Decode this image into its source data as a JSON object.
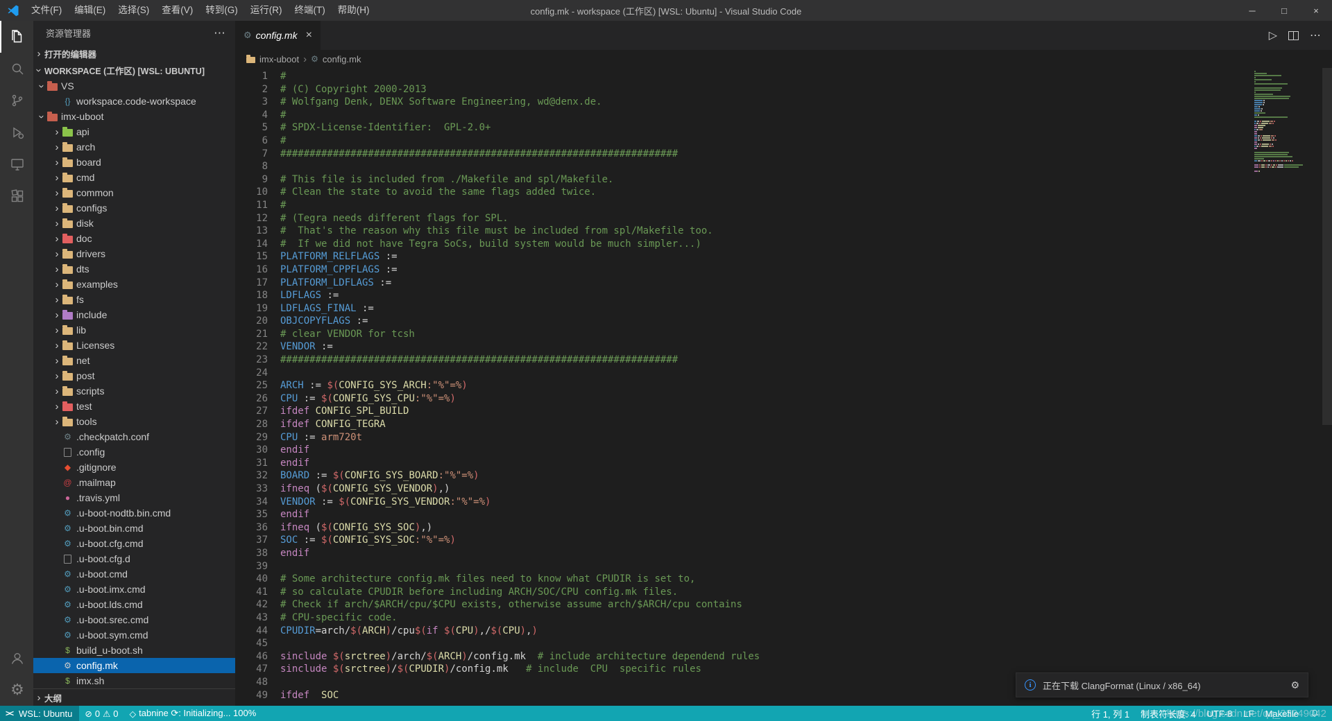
{
  "colors": {
    "titlebar": "#323233",
    "activitybar": "#333333",
    "sidebar": "#252526",
    "editor": "#1e1e1e",
    "statusbar": "#12a5b2",
    "statusbar_remote": "#0a7d8c",
    "selection": "#0a64ad",
    "vscode_blue": "#1f9cf0",
    "tok_c": "#6a9955",
    "tok_v": "#569cd6",
    "tok_k": "#c586c0",
    "tok_o": "#d4d4d4",
    "tok_d": "#d16969",
    "tok_n": "#dcdcaa",
    "tok_s": "#ce9178"
  },
  "title_bar": {
    "menus": [
      "文件(F)",
      "编辑(E)",
      "选择(S)",
      "查看(V)",
      "转到(G)",
      "运行(R)",
      "终端(T)",
      "帮助(H)"
    ],
    "title": "config.mk - workspace (工作区) [WSL: Ubuntu] - Visual Studio Code",
    "controls": {
      "minimize": "─",
      "maximize": "□",
      "close": "×"
    }
  },
  "activity_bar": {
    "icons": [
      "explorer-icon",
      "search-icon",
      "source-control-icon",
      "run-debug-icon",
      "remote-explorer-icon",
      "extensions-icon",
      "account-icon",
      "settings-gear-icon"
    ]
  },
  "sidebar": {
    "title": "资源管理器",
    "open_editors_label": "打开的编辑器",
    "workspace_label": "WORKSPACE (工作区) [WSL: UBUNTU]",
    "outline_label": "大纲",
    "tree": [
      {
        "label": "VS",
        "depth": 0,
        "icon": "folder",
        "icon_color": "#c65f4e",
        "chevron": true,
        "expanded": true
      },
      {
        "label": "workspace.code-workspace",
        "depth": 1,
        "icon": "braces",
        "icon_color": "#519aba"
      },
      {
        "label": "imx-uboot",
        "depth": 0,
        "icon": "folder",
        "icon_color": "#c65f4e",
        "chevron": true,
        "expanded": true
      },
      {
        "label": "api",
        "depth": 1,
        "icon": "folder",
        "icon_color": "#8bc34a",
        "chevron": true
      },
      {
        "label": "arch",
        "depth": 1,
        "icon": "folder",
        "icon_color": "#dcb67a",
        "chevron": true
      },
      {
        "label": "board",
        "depth": 1,
        "icon": "folder",
        "icon_color": "#dcb67a",
        "chevron": true
      },
      {
        "label": "cmd",
        "depth": 1,
        "icon": "folder",
        "icon_color": "#dcb67a",
        "chevron": true
      },
      {
        "label": "common",
        "depth": 1,
        "icon": "folder",
        "icon_color": "#dcb67a",
        "chevron": true
      },
      {
        "label": "configs",
        "depth": 1,
        "icon": "folder",
        "icon_color": "#dcb67a",
        "chevron": true
      },
      {
        "label": "disk",
        "depth": 1,
        "icon": "folder",
        "icon_color": "#dcb67a",
        "chevron": true
      },
      {
        "label": "doc",
        "depth": 1,
        "icon": "folder",
        "icon_color": "#e25f5f",
        "chevron": true
      },
      {
        "label": "drivers",
        "depth": 1,
        "icon": "folder",
        "icon_color": "#dcb67a",
        "chevron": true
      },
      {
        "label": "dts",
        "depth": 1,
        "icon": "folder",
        "icon_color": "#dcb67a",
        "chevron": true
      },
      {
        "label": "examples",
        "depth": 1,
        "icon": "folder",
        "icon_color": "#dcb67a",
        "chevron": true
      },
      {
        "label": "fs",
        "depth": 1,
        "icon": "folder",
        "icon_color": "#dcb67a",
        "chevron": true
      },
      {
        "label": "include",
        "depth": 1,
        "icon": "folder",
        "icon_color": "#b07cc6",
        "chevron": true
      },
      {
        "label": "lib",
        "depth": 1,
        "icon": "folder",
        "icon_color": "#dcb67a",
        "chevron": true
      },
      {
        "label": "Licenses",
        "depth": 1,
        "icon": "folder",
        "icon_color": "#dcb67a",
        "chevron": true
      },
      {
        "label": "net",
        "depth": 1,
        "icon": "folder",
        "icon_color": "#dcb67a",
        "chevron": true
      },
      {
        "label": "post",
        "depth": 1,
        "icon": "folder",
        "icon_color": "#dcb67a",
        "chevron": true
      },
      {
        "label": "scripts",
        "depth": 1,
        "icon": "folder",
        "icon_color": "#dcb67a",
        "chevron": true
      },
      {
        "label": "test",
        "depth": 1,
        "icon": "folder",
        "icon_color": "#e25f5f",
        "chevron": true
      },
      {
        "label": "tools",
        "depth": 1,
        "icon": "folder",
        "icon_color": "#dcb67a",
        "chevron": true
      },
      {
        "label": ".checkpatch.conf",
        "depth": 1,
        "icon": "gear",
        "icon_color": "#6d8086"
      },
      {
        "label": ".config",
        "depth": 1,
        "icon": "file",
        "icon_color": "#c5c5c5"
      },
      {
        "label": ".gitignore",
        "depth": 1,
        "icon": "git",
        "icon_color": "#e84e31"
      },
      {
        "label": ".mailmap",
        "depth": 1,
        "icon": "at",
        "icon_color": "#cc3e44"
      },
      {
        "label": ".travis.yml",
        "depth": 1,
        "icon": "dot",
        "icon_color": "#cb6699"
      },
      {
        "label": ".u-boot-nodtb.bin.cmd",
        "depth": 1,
        "icon": "gear",
        "icon_color": "#519aba"
      },
      {
        "label": ".u-boot.bin.cmd",
        "depth": 1,
        "icon": "gear",
        "icon_color": "#519aba"
      },
      {
        "label": ".u-boot.cfg.cmd",
        "depth": 1,
        "icon": "gear",
        "icon_color": "#519aba"
      },
      {
        "label": ".u-boot.cfg.d",
        "depth": 1,
        "icon": "file",
        "icon_color": "#c5c5c5"
      },
      {
        "label": ".u-boot.cmd",
        "depth": 1,
        "icon": "gear",
        "icon_color": "#519aba"
      },
      {
        "label": ".u-boot.imx.cmd",
        "depth": 1,
        "icon": "gear",
        "icon_color": "#519aba"
      },
      {
        "label": ".u-boot.lds.cmd",
        "depth": 1,
        "icon": "gear",
        "icon_color": "#519aba"
      },
      {
        "label": ".u-boot.srec.cmd",
        "depth": 1,
        "icon": "gear",
        "icon_color": "#519aba"
      },
      {
        "label": ".u-boot.sym.cmd",
        "depth": 1,
        "icon": "gear",
        "icon_color": "#519aba"
      },
      {
        "label": "build_u-boot.sh",
        "depth": 1,
        "icon": "dollar",
        "icon_color": "#89b55a"
      },
      {
        "label": "config.mk",
        "depth": 1,
        "icon": "gear",
        "icon_color": "#cccccc",
        "selected": true
      },
      {
        "label": "imx.sh",
        "depth": 1,
        "icon": "dollar",
        "icon_color": "#89b55a"
      }
    ]
  },
  "editor": {
    "tab": {
      "label": "config.mk",
      "close": "×"
    },
    "action_icons": [
      "run-icon",
      "split-editor-icon",
      "more-actions-icon"
    ],
    "breadcrumb": [
      {
        "label": "imx-uboot",
        "icon": "folder-icon"
      },
      {
        "label": "config.mk",
        "icon": "gear-icon"
      }
    ],
    "code": {
      "language": "Makefile",
      "lines": [
        [
          [
            "c",
            "#"
          ]
        ],
        [
          [
            "c",
            "# (C) Copyright 2000-2013"
          ]
        ],
        [
          [
            "c",
            "# Wolfgang Denk, DENX Software Engineering, wd@denx.de."
          ]
        ],
        [
          [
            "c",
            "#"
          ]
        ],
        [
          [
            "c",
            "# SPDX-License-Identifier:  GPL-2.0+"
          ]
        ],
        [
          [
            "c",
            "#"
          ]
        ],
        [
          [
            "c",
            "####################################################################"
          ]
        ],
        [],
        [
          [
            "c",
            "# This file is included from ./Makefile and spl/Makefile."
          ]
        ],
        [
          [
            "c",
            "# Clean the state to avoid the same flags added twice."
          ]
        ],
        [
          [
            "c",
            "#"
          ]
        ],
        [
          [
            "c",
            "# (Tegra needs different flags for SPL."
          ]
        ],
        [
          [
            "c",
            "#  That's the reason why this file must be included from spl/Makefile too."
          ]
        ],
        [
          [
            "c",
            "#  If we did not have Tegra SoCs, build system would be much simpler...)"
          ]
        ],
        [
          [
            "v",
            "PLATFORM_RELFLAGS"
          ],
          [
            "o",
            " :="
          ]
        ],
        [
          [
            "v",
            "PLATFORM_CPPFLAGS"
          ],
          [
            "o",
            " :="
          ]
        ],
        [
          [
            "v",
            "PLATFORM_LDFLAGS"
          ],
          [
            "o",
            " :="
          ]
        ],
        [
          [
            "v",
            "LDFLAGS"
          ],
          [
            "o",
            " :="
          ]
        ],
        [
          [
            "v",
            "LDFLAGS_FINAL"
          ],
          [
            "o",
            " :="
          ]
        ],
        [
          [
            "v",
            "OBJCOPYFLAGS"
          ],
          [
            "o",
            " :="
          ]
        ],
        [
          [
            "c",
            "# clear VENDOR for tcsh"
          ]
        ],
        [
          [
            "v",
            "VENDOR"
          ],
          [
            "o",
            " :="
          ]
        ],
        [
          [
            "c",
            "####################################################################"
          ]
        ],
        [],
        [
          [
            "v",
            "ARCH"
          ],
          [
            "o",
            " := "
          ],
          [
            "d",
            "$("
          ],
          [
            "n",
            "CONFIG_SYS_ARCH"
          ],
          [
            "s",
            ":\"%\"=%"
          ],
          [
            "d",
            ")"
          ]
        ],
        [
          [
            "v",
            "CPU"
          ],
          [
            "o",
            " := "
          ],
          [
            "d",
            "$("
          ],
          [
            "n",
            "CONFIG_SYS_CPU"
          ],
          [
            "s",
            ":\"%\"=%"
          ],
          [
            "d",
            ")"
          ]
        ],
        [
          [
            "k",
            "ifdef "
          ],
          [
            "n",
            "CONFIG_SPL_BUILD"
          ]
        ],
        [
          [
            "k",
            "ifdef "
          ],
          [
            "n",
            "CONFIG_TEGRA"
          ]
        ],
        [
          [
            "v",
            "CPU"
          ],
          [
            "o",
            " := "
          ],
          [
            "s",
            "arm720t"
          ]
        ],
        [
          [
            "k",
            "endif"
          ]
        ],
        [
          [
            "k",
            "endif"
          ]
        ],
        [
          [
            "v",
            "BOARD"
          ],
          [
            "o",
            " := "
          ],
          [
            "d",
            "$("
          ],
          [
            "n",
            "CONFIG_SYS_BOARD"
          ],
          [
            "s",
            ":\"%\"=%"
          ],
          [
            "d",
            ")"
          ]
        ],
        [
          [
            "k",
            "ifneq "
          ],
          [
            "o",
            "("
          ],
          [
            "d",
            "$("
          ],
          [
            "n",
            "CONFIG_SYS_VENDOR"
          ],
          [
            "d",
            ")"
          ],
          [
            "o",
            ",)"
          ]
        ],
        [
          [
            "v",
            "VENDOR"
          ],
          [
            "o",
            " := "
          ],
          [
            "d",
            "$("
          ],
          [
            "n",
            "CONFIG_SYS_VENDOR"
          ],
          [
            "s",
            ":\"%\"=%"
          ],
          [
            "d",
            ")"
          ]
        ],
        [
          [
            "k",
            "endif"
          ]
        ],
        [
          [
            "k",
            "ifneq "
          ],
          [
            "o",
            "("
          ],
          [
            "d",
            "$("
          ],
          [
            "n",
            "CONFIG_SYS_SOC"
          ],
          [
            "d",
            ")"
          ],
          [
            "o",
            ",)"
          ]
        ],
        [
          [
            "v",
            "SOC"
          ],
          [
            "o",
            " := "
          ],
          [
            "d",
            "$("
          ],
          [
            "n",
            "CONFIG_SYS_SOC"
          ],
          [
            "s",
            ":\"%\"=%"
          ],
          [
            "d",
            ")"
          ]
        ],
        [
          [
            "k",
            "endif"
          ]
        ],
        [],
        [
          [
            "c",
            "# Some architecture config.mk files need to know what CPUDIR is set to,"
          ]
        ],
        [
          [
            "c",
            "# so calculate CPUDIR before including ARCH/SOC/CPU config.mk files."
          ]
        ],
        [
          [
            "c",
            "# Check if arch/$ARCH/cpu/$CPU exists, otherwise assume arch/$ARCH/cpu contains"
          ]
        ],
        [
          [
            "c",
            "# CPU-specific code."
          ]
        ],
        [
          [
            "v",
            "CPUDIR"
          ],
          [
            "o",
            "=arch/"
          ],
          [
            "d",
            "$("
          ],
          [
            "n",
            "ARCH"
          ],
          [
            "d",
            ")"
          ],
          [
            "o",
            "/cpu"
          ],
          [
            "d",
            "$("
          ],
          [
            "k",
            "if "
          ],
          [
            "d",
            "$("
          ],
          [
            "n",
            "CPU"
          ],
          [
            "d",
            ")"
          ],
          [
            "o",
            ",/"
          ],
          [
            "d",
            "$("
          ],
          [
            "n",
            "CPU"
          ],
          [
            "d",
            ")"
          ],
          [
            "o",
            ","
          ],
          [
            "d",
            ")"
          ]
        ],
        [],
        [
          [
            "k",
            "sinclude "
          ],
          [
            "d",
            "$("
          ],
          [
            "n",
            "srctree"
          ],
          [
            "d",
            ")"
          ],
          [
            "o",
            "/arch/"
          ],
          [
            "d",
            "$("
          ],
          [
            "n",
            "ARCH"
          ],
          [
            "d",
            ")"
          ],
          [
            "o",
            "/config.mk  "
          ],
          [
            "c",
            "# include architecture dependend rules"
          ]
        ],
        [
          [
            "k",
            "sinclude "
          ],
          [
            "d",
            "$("
          ],
          [
            "n",
            "srctree"
          ],
          [
            "d",
            ")"
          ],
          [
            "o",
            "/"
          ],
          [
            "d",
            "$("
          ],
          [
            "n",
            "CPUDIR"
          ],
          [
            "d",
            ")"
          ],
          [
            "o",
            "/config.mk   "
          ],
          [
            "c",
            "# include  CPU  specific rules"
          ]
        ],
        [],
        [
          [
            "k",
            "ifdef  "
          ],
          [
            "n",
            "SOC"
          ]
        ]
      ]
    }
  },
  "notification": {
    "text": "正在下载 ClangFormat (Linux / x86_64)"
  },
  "status_bar": {
    "remote": "WSL: Ubuntu",
    "errors": "0",
    "warnings": "0",
    "tabnine": "tabnine ⟳: Initializing... 100%",
    "line_col": "行 1, 列 1",
    "tab_size": "制表符长度: 4",
    "encoding": "UTF-8",
    "eol": "LF",
    "language": "Makefile"
  },
  "watermark": "https://blog.csdn.net/qq_33249042"
}
